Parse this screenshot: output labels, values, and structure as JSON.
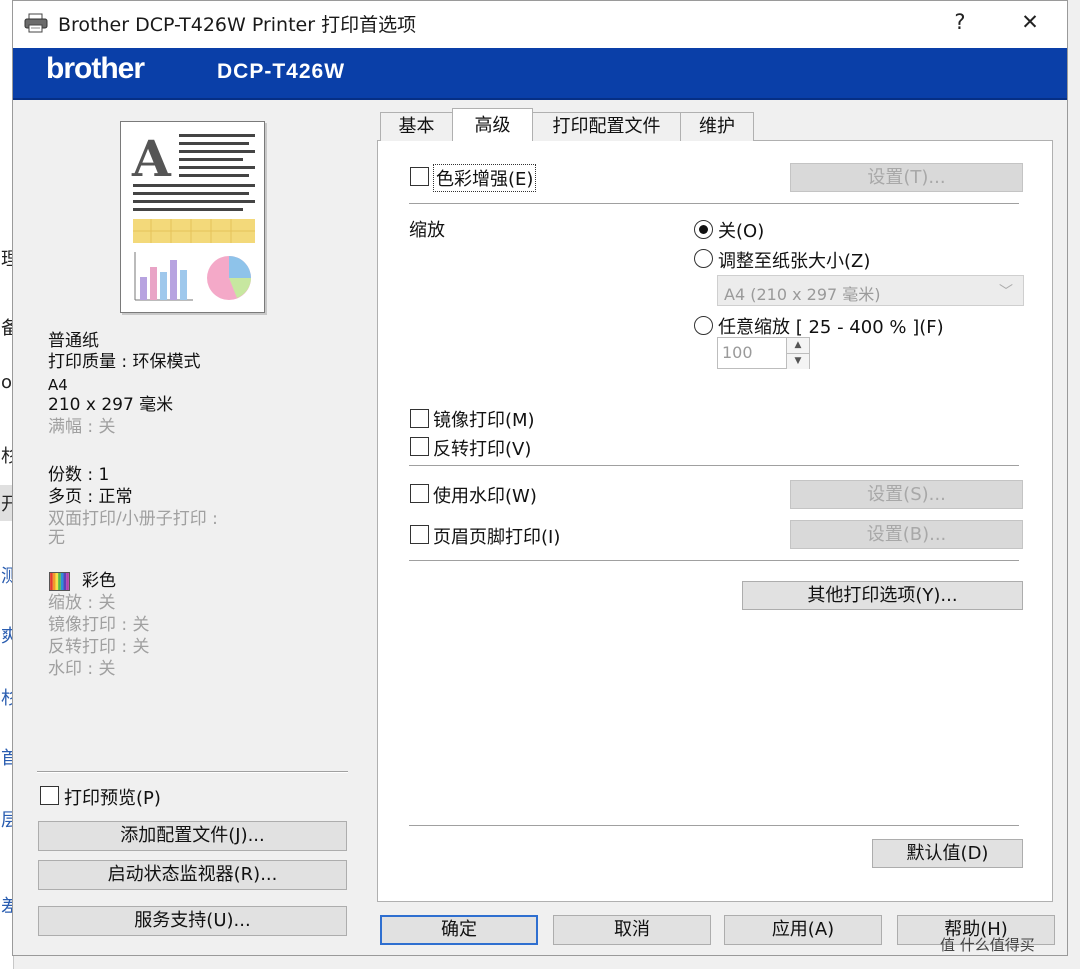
{
  "background_window": {
    "fragments": [
      "理",
      "备",
      "o",
      "杉",
      "开",
      "测",
      "爽",
      "杉",
      "首",
      "层",
      "差"
    ]
  },
  "window": {
    "title": "Brother DCP-T426W Printer 打印首选项",
    "help_label": "?",
    "close_label": "✕"
  },
  "banner": {
    "brand": "brother",
    "model": "DCP-T426W"
  },
  "summary": {
    "paper": "普通纸",
    "quality_label": "打印质量",
    "quality_value": "环保模式",
    "size": "A4",
    "dimensions": "210 x 297 毫米",
    "borderless_label": "满幅",
    "borderless_value": "关",
    "copies_label": "份数",
    "copies_value": "1",
    "multipage_label": "多页",
    "multipage_value": "正常",
    "duplex_label": "双面打印/小册子打印",
    "duplex_value": "无",
    "color_label": "彩色",
    "scaling_label": "缩放",
    "scaling_value": "关",
    "mirror_label": "镜像打印",
    "mirror_value": "关",
    "reverse_label": "反转打印",
    "reverse_value": "关",
    "watermark_label": "水印",
    "watermark_value": "关",
    "separator": ":"
  },
  "left_controls": {
    "preview_checkbox": "打印预览(P)",
    "add_profile_button": "添加配置文件(J)...",
    "status_monitor_button": "启动状态监视器(R)...",
    "support_button": "服务支持(U)..."
  },
  "tabs": [
    {
      "label": "基本",
      "active": false
    },
    {
      "label": "高级",
      "active": true
    },
    {
      "label": "打印配置文件",
      "active": false
    },
    {
      "label": "维护",
      "active": false
    }
  ],
  "advanced": {
    "color_enhance": "色彩增强(E)",
    "color_settings_button": "设置(T)...",
    "scaling_label": "缩放",
    "radio_off": "关(O)",
    "radio_fit": "调整至纸张大小(Z)",
    "paper_select_value": "A4 (210 x 297 毫米)",
    "radio_free": "任意缩放 [ 25 - 400 % ](F)",
    "scale_value": "100",
    "mirror_print": "镜像打印(M)",
    "reverse_print": "反转打印(V)",
    "use_watermark": "使用水印(W)",
    "watermark_settings_button": "设置(S)...",
    "header_footer": "页眉页脚打印(I)",
    "header_footer_settings_button": "设置(B)...",
    "other_options_button": "其他打印选项(Y)...",
    "default_button": "默认值(D)"
  },
  "footer": {
    "ok": "确定",
    "cancel": "取消",
    "apply": "应用(A)",
    "help": "帮助(H)"
  },
  "watermark": {
    "text": "值 什么值得买"
  },
  "colors": {
    "banner": "#0a3fa8",
    "default_button_border": "#2f6fd0"
  }
}
